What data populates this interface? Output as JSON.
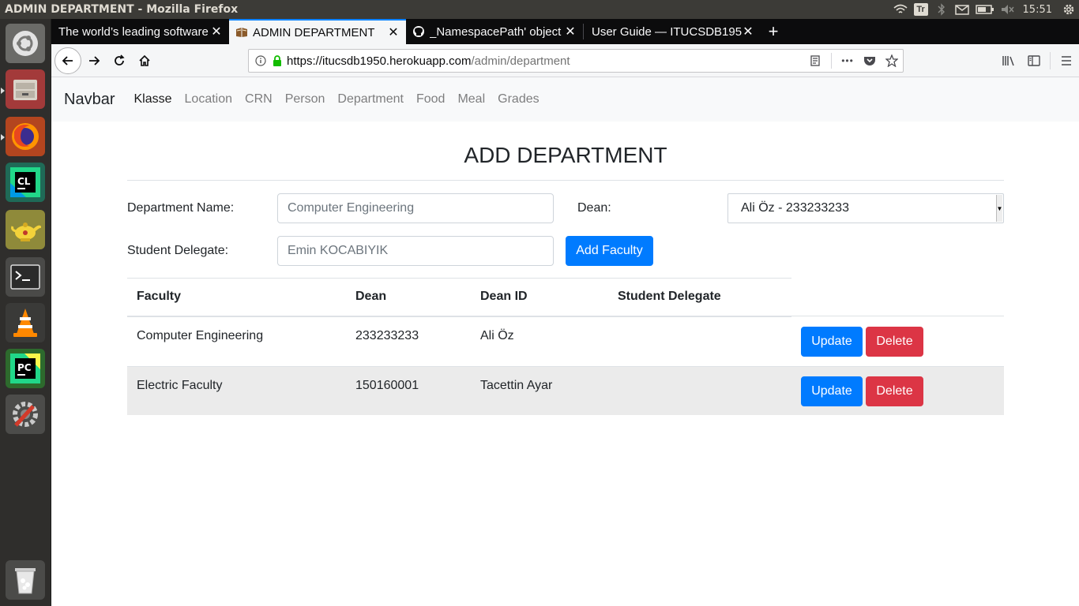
{
  "os": {
    "window_title": "ADMIN DEPARTMENT - Mozilla Firefox",
    "keyboard_indicator": "Tr",
    "clock": "15:51"
  },
  "browser": {
    "tabs": [
      {
        "title": "The world’s leading software",
        "active": false
      },
      {
        "title": "ADMIN DEPARTMENT",
        "active": true
      },
      {
        "title": "_NamespacePath' object",
        "active": false
      },
      {
        "title": "User Guide — ITUCSDB1950",
        "active": false
      }
    ],
    "new_tab_label": "+",
    "url_host": "https://itucsdb1950.herokuapp.com",
    "url_path": "/admin/department",
    "more_label": "•••"
  },
  "site_nav": {
    "brand": "Navbar",
    "links": [
      "Klasse",
      "Location",
      "CRN",
      "Person",
      "Department",
      "Food",
      "Meal",
      "Grades"
    ]
  },
  "form": {
    "title": "ADD DEPARTMENT",
    "department_name_label": "Department Name:",
    "department_name_placeholder": "Computer Engineering",
    "dean_label": "Dean:",
    "dean_selected": "Ali Öz - 233233233",
    "student_delegate_label": "Student Delegate:",
    "student_delegate_placeholder": "Emin KOCABIYIK",
    "submit_label": "Add Faculty"
  },
  "table": {
    "headers": [
      "Faculty",
      "Dean",
      "Dean ID",
      "Student Delegate"
    ],
    "rows": [
      {
        "faculty": "Computer Engineering",
        "dean": "233233233",
        "dean_id": "Ali Öz",
        "student_delegate": ""
      },
      {
        "faculty": "Electric Faculty",
        "dean": "150160001",
        "dean_id": "Tacettin Ayar",
        "student_delegate": ""
      }
    ],
    "update_label": "Update",
    "delete_label": "Delete"
  },
  "colors": {
    "primary": "#007bff",
    "danger": "#dc3545",
    "tab_accent": "#0a84ff",
    "secure_lock": "#12bc00"
  }
}
